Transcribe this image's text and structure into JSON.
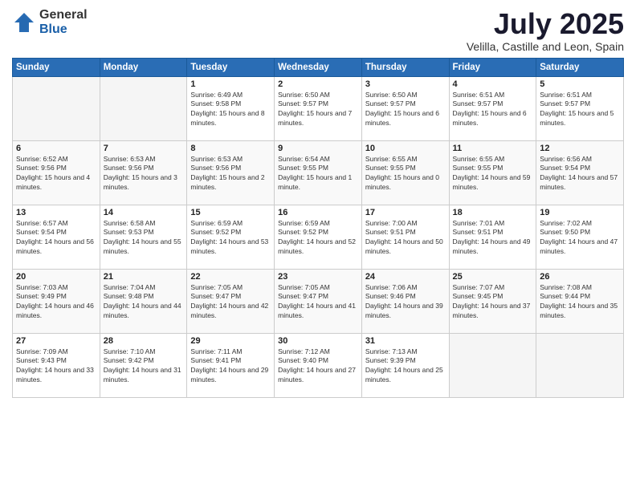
{
  "logo": {
    "general": "General",
    "blue": "Blue"
  },
  "header": {
    "month": "July 2025",
    "location": "Velilla, Castille and Leon, Spain"
  },
  "weekdays": [
    "Sunday",
    "Monday",
    "Tuesday",
    "Wednesday",
    "Thursday",
    "Friday",
    "Saturday"
  ],
  "weeks": [
    [
      {
        "day": "",
        "sunrise": "",
        "sunset": "",
        "daylight": ""
      },
      {
        "day": "",
        "sunrise": "",
        "sunset": "",
        "daylight": ""
      },
      {
        "day": "1",
        "sunrise": "Sunrise: 6:49 AM",
        "sunset": "Sunset: 9:58 PM",
        "daylight": "Daylight: 15 hours and 8 minutes."
      },
      {
        "day": "2",
        "sunrise": "Sunrise: 6:50 AM",
        "sunset": "Sunset: 9:57 PM",
        "daylight": "Daylight: 15 hours and 7 minutes."
      },
      {
        "day": "3",
        "sunrise": "Sunrise: 6:50 AM",
        "sunset": "Sunset: 9:57 PM",
        "daylight": "Daylight: 15 hours and 6 minutes."
      },
      {
        "day": "4",
        "sunrise": "Sunrise: 6:51 AM",
        "sunset": "Sunset: 9:57 PM",
        "daylight": "Daylight: 15 hours and 6 minutes."
      },
      {
        "day": "5",
        "sunrise": "Sunrise: 6:51 AM",
        "sunset": "Sunset: 9:57 PM",
        "daylight": "Daylight: 15 hours and 5 minutes."
      }
    ],
    [
      {
        "day": "6",
        "sunrise": "Sunrise: 6:52 AM",
        "sunset": "Sunset: 9:56 PM",
        "daylight": "Daylight: 15 hours and 4 minutes."
      },
      {
        "day": "7",
        "sunrise": "Sunrise: 6:53 AM",
        "sunset": "Sunset: 9:56 PM",
        "daylight": "Daylight: 15 hours and 3 minutes."
      },
      {
        "day": "8",
        "sunrise": "Sunrise: 6:53 AM",
        "sunset": "Sunset: 9:56 PM",
        "daylight": "Daylight: 15 hours and 2 minutes."
      },
      {
        "day": "9",
        "sunrise": "Sunrise: 6:54 AM",
        "sunset": "Sunset: 9:55 PM",
        "daylight": "Daylight: 15 hours and 1 minute."
      },
      {
        "day": "10",
        "sunrise": "Sunrise: 6:55 AM",
        "sunset": "Sunset: 9:55 PM",
        "daylight": "Daylight: 15 hours and 0 minutes."
      },
      {
        "day": "11",
        "sunrise": "Sunrise: 6:55 AM",
        "sunset": "Sunset: 9:55 PM",
        "daylight": "Daylight: 14 hours and 59 minutes."
      },
      {
        "day": "12",
        "sunrise": "Sunrise: 6:56 AM",
        "sunset": "Sunset: 9:54 PM",
        "daylight": "Daylight: 14 hours and 57 minutes."
      }
    ],
    [
      {
        "day": "13",
        "sunrise": "Sunrise: 6:57 AM",
        "sunset": "Sunset: 9:54 PM",
        "daylight": "Daylight: 14 hours and 56 minutes."
      },
      {
        "day": "14",
        "sunrise": "Sunrise: 6:58 AM",
        "sunset": "Sunset: 9:53 PM",
        "daylight": "Daylight: 14 hours and 55 minutes."
      },
      {
        "day": "15",
        "sunrise": "Sunrise: 6:59 AM",
        "sunset": "Sunset: 9:52 PM",
        "daylight": "Daylight: 14 hours and 53 minutes."
      },
      {
        "day": "16",
        "sunrise": "Sunrise: 6:59 AM",
        "sunset": "Sunset: 9:52 PM",
        "daylight": "Daylight: 14 hours and 52 minutes."
      },
      {
        "day": "17",
        "sunrise": "Sunrise: 7:00 AM",
        "sunset": "Sunset: 9:51 PM",
        "daylight": "Daylight: 14 hours and 50 minutes."
      },
      {
        "day": "18",
        "sunrise": "Sunrise: 7:01 AM",
        "sunset": "Sunset: 9:51 PM",
        "daylight": "Daylight: 14 hours and 49 minutes."
      },
      {
        "day": "19",
        "sunrise": "Sunrise: 7:02 AM",
        "sunset": "Sunset: 9:50 PM",
        "daylight": "Daylight: 14 hours and 47 minutes."
      }
    ],
    [
      {
        "day": "20",
        "sunrise": "Sunrise: 7:03 AM",
        "sunset": "Sunset: 9:49 PM",
        "daylight": "Daylight: 14 hours and 46 minutes."
      },
      {
        "day": "21",
        "sunrise": "Sunrise: 7:04 AM",
        "sunset": "Sunset: 9:48 PM",
        "daylight": "Daylight: 14 hours and 44 minutes."
      },
      {
        "day": "22",
        "sunrise": "Sunrise: 7:05 AM",
        "sunset": "Sunset: 9:47 PM",
        "daylight": "Daylight: 14 hours and 42 minutes."
      },
      {
        "day": "23",
        "sunrise": "Sunrise: 7:05 AM",
        "sunset": "Sunset: 9:47 PM",
        "daylight": "Daylight: 14 hours and 41 minutes."
      },
      {
        "day": "24",
        "sunrise": "Sunrise: 7:06 AM",
        "sunset": "Sunset: 9:46 PM",
        "daylight": "Daylight: 14 hours and 39 minutes."
      },
      {
        "day": "25",
        "sunrise": "Sunrise: 7:07 AM",
        "sunset": "Sunset: 9:45 PM",
        "daylight": "Daylight: 14 hours and 37 minutes."
      },
      {
        "day": "26",
        "sunrise": "Sunrise: 7:08 AM",
        "sunset": "Sunset: 9:44 PM",
        "daylight": "Daylight: 14 hours and 35 minutes."
      }
    ],
    [
      {
        "day": "27",
        "sunrise": "Sunrise: 7:09 AM",
        "sunset": "Sunset: 9:43 PM",
        "daylight": "Daylight: 14 hours and 33 minutes."
      },
      {
        "day": "28",
        "sunrise": "Sunrise: 7:10 AM",
        "sunset": "Sunset: 9:42 PM",
        "daylight": "Daylight: 14 hours and 31 minutes."
      },
      {
        "day": "29",
        "sunrise": "Sunrise: 7:11 AM",
        "sunset": "Sunset: 9:41 PM",
        "daylight": "Daylight: 14 hours and 29 minutes."
      },
      {
        "day": "30",
        "sunrise": "Sunrise: 7:12 AM",
        "sunset": "Sunset: 9:40 PM",
        "daylight": "Daylight: 14 hours and 27 minutes."
      },
      {
        "day": "31",
        "sunrise": "Sunrise: 7:13 AM",
        "sunset": "Sunset: 9:39 PM",
        "daylight": "Daylight: 14 hours and 25 minutes."
      },
      {
        "day": "",
        "sunrise": "",
        "sunset": "",
        "daylight": ""
      },
      {
        "day": "",
        "sunrise": "",
        "sunset": "",
        "daylight": ""
      }
    ]
  ]
}
